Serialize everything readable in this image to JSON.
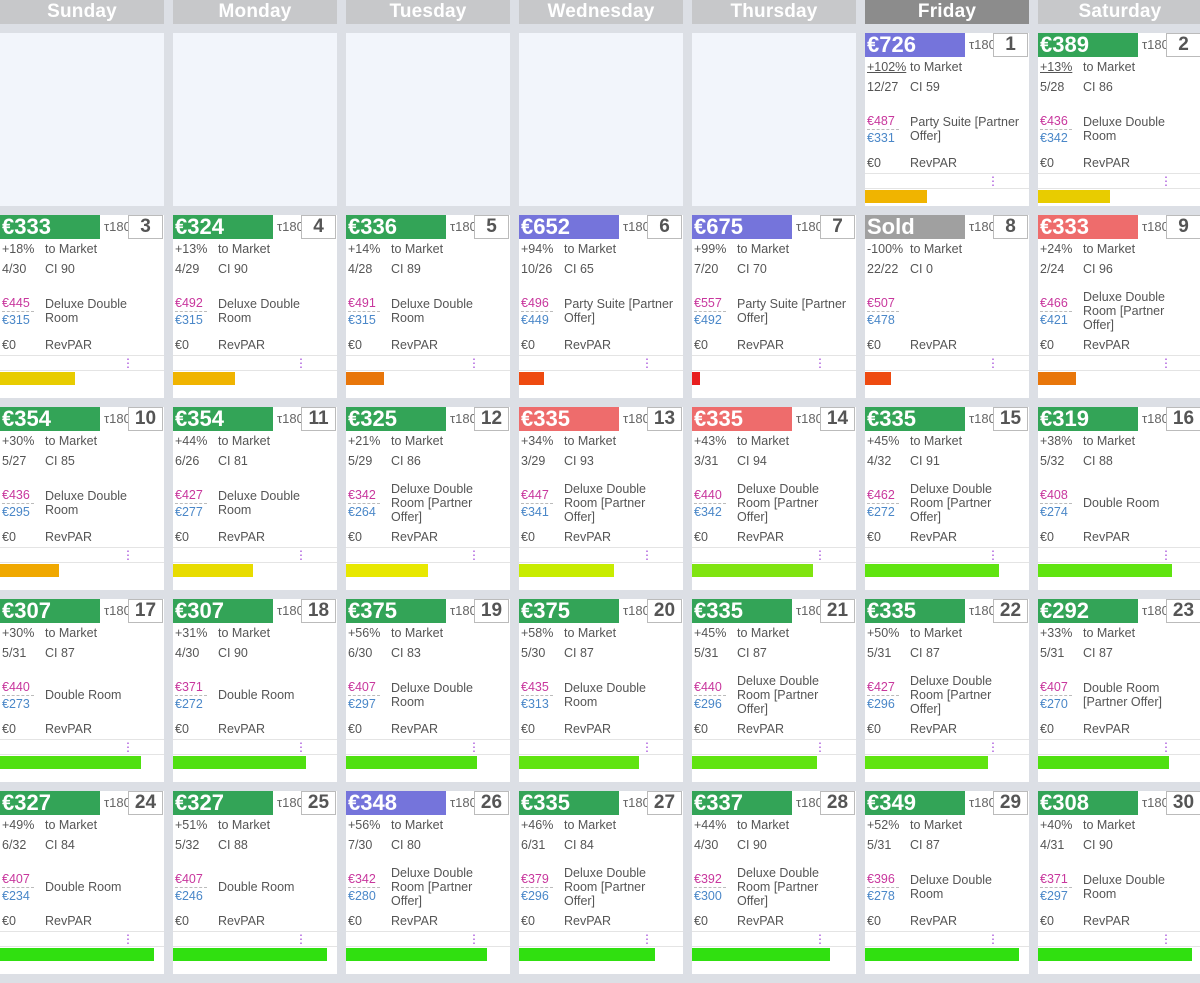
{
  "days": [
    "Sunday",
    "Monday",
    "Tuesday",
    "Wednesday",
    "Thursday",
    "Friday",
    "Saturday"
  ],
  "active_day": 5,
  "labels": {
    "market": "to Market",
    "revpar": "RevPAR",
    "tau": "τ180",
    "menu": "⋮"
  },
  "weeks": [
    [
      null,
      null,
      null,
      null,
      null,
      {
        "day": "1",
        "price": "€726",
        "price_color": "#7574db",
        "pct": "+102%",
        "occ": "12/27",
        "ci": "CI 59",
        "rate_a": "€487",
        "rate_b": "€331",
        "room": "Party Suite [Partner Offer]",
        "rev": "€0",
        "bar": 0.38,
        "bar_color": "#f0b400"
      },
      {
        "day": "2",
        "price": "€389",
        "price_color": "#33a457",
        "pct": "+13%",
        "occ": "5/28",
        "ci": "CI 86",
        "rate_a": "€436",
        "rate_b": "€342",
        "room": "Deluxe Double Room",
        "rev": "€0",
        "bar": 0.44,
        "bar_color": "#e8cc00"
      }
    ],
    [
      {
        "day": "3",
        "price": "€333",
        "price_color": "#33a457",
        "pct": "+18%",
        "occ": "4/30",
        "ci": "CI 90",
        "rate_a": "€445",
        "rate_b": "€315",
        "room": "Deluxe Double Room",
        "rev": "€0",
        "bar": 0.46,
        "bar_color": "#e8cc00"
      },
      {
        "day": "4",
        "price": "€324",
        "price_color": "#33a457",
        "pct": "+13%",
        "occ": "4/29",
        "ci": "CI 90",
        "rate_a": "€492",
        "rate_b": "€315",
        "room": "Deluxe Double Room",
        "rev": "€0",
        "bar": 0.38,
        "bar_color": "#f0b400"
      },
      {
        "day": "5",
        "price": "€336",
        "price_color": "#33a457",
        "pct": "+14%",
        "occ": "4/28",
        "ci": "CI 89",
        "rate_a": "€491",
        "rate_b": "€315",
        "room": "Deluxe Double Room",
        "rev": "€0",
        "bar": 0.23,
        "bar_color": "#e8760a"
      },
      {
        "day": "6",
        "price": "€652",
        "price_color": "#7574db",
        "pct": "+94%",
        "occ": "10/26",
        "ci": "CI 65",
        "rate_a": "€496",
        "rate_b": "€449",
        "room": "Party Suite [Partner Offer]",
        "rev": "€0",
        "bar": 0.15,
        "bar_color": "#ee4a10"
      },
      {
        "day": "7",
        "price": "€675",
        "price_color": "#7574db",
        "pct": "+99%",
        "occ": "7/20",
        "ci": "CI 70",
        "rate_a": "€557",
        "rate_b": "€492",
        "room": "Party Suite [Partner Offer]",
        "rev": "€0",
        "bar": 0.05,
        "bar_color": "#e81e1e"
      },
      {
        "day": "8",
        "price": "Sold",
        "price_color": "#a0a0a0",
        "pct": "-100%",
        "occ": "22/22",
        "ci": "CI 0",
        "rate_a": "€507",
        "rate_b": "€478",
        "room": "",
        "rev": "€0",
        "bar": 0.16,
        "bar_color": "#ee4a10"
      },
      {
        "day": "9",
        "price": "€333",
        "price_color": "#ee6c6c",
        "pct": "+24%",
        "occ": "2/24",
        "ci": "CI 96",
        "rate_a": "€466",
        "rate_b": "€421",
        "room": "Deluxe Double Room [Partner Offer]",
        "rev": "€0",
        "bar": 0.23,
        "bar_color": "#e8760a"
      }
    ],
    [
      {
        "day": "10",
        "price": "€354",
        "price_color": "#33a457",
        "pct": "+30%",
        "occ": "5/27",
        "ci": "CI 85",
        "rate_a": "€436",
        "rate_b": "€295",
        "room": "Deluxe Double Room",
        "rev": "€0",
        "bar": 0.36,
        "bar_color": "#f0a800"
      },
      {
        "day": "11",
        "price": "€354",
        "price_color": "#33a457",
        "pct": "+44%",
        "occ": "6/26",
        "ci": "CI 81",
        "rate_a": "€427",
        "rate_b": "€277",
        "room": "Deluxe Double Room",
        "rev": "€0",
        "bar": 0.49,
        "bar_color": "#e8dc00"
      },
      {
        "day": "12",
        "price": "€325",
        "price_color": "#33a457",
        "pct": "+21%",
        "occ": "5/29",
        "ci": "CI 86",
        "rate_a": "€342",
        "rate_b": "€264",
        "room": "Deluxe Double Room [Partner Offer]",
        "rev": "€0",
        "bar": 0.5,
        "bar_color": "#e8e800"
      },
      {
        "day": "13",
        "price": "€335",
        "price_color": "#ee6c6c",
        "pct": "+34%",
        "occ": "3/29",
        "ci": "CI 93",
        "rate_a": "€447",
        "rate_b": "€341",
        "room": "Deluxe Double Room [Partner Offer]",
        "rev": "€0",
        "bar": 0.58,
        "bar_color": "#c8ec00"
      },
      {
        "day": "14",
        "price": "€335",
        "price_color": "#ee6c6c",
        "pct": "+43%",
        "occ": "3/31",
        "ci": "CI 94",
        "rate_a": "€440",
        "rate_b": "€342",
        "room": "Deluxe Double Room [Partner Offer]",
        "rev": "€0",
        "bar": 0.74,
        "bar_color": "#80e410"
      },
      {
        "day": "15",
        "price": "€335",
        "price_color": "#33a457",
        "pct": "+45%",
        "occ": "4/32",
        "ci": "CI 91",
        "rate_a": "€462",
        "rate_b": "€272",
        "room": "Deluxe Double Room [Partner Offer]",
        "rev": "€0",
        "bar": 0.82,
        "bar_color": "#60e410"
      },
      {
        "day": "16",
        "price": "€319",
        "price_color": "#33a457",
        "pct": "+38%",
        "occ": "5/32",
        "ci": "CI 88",
        "rate_a": "€408",
        "rate_b": "€274",
        "room": "Double Room",
        "rev": "€0",
        "bar": 0.82,
        "bar_color": "#60e410"
      }
    ],
    [
      {
        "day": "17",
        "price": "€307",
        "price_color": "#33a457",
        "pct": "+30%",
        "occ": "5/31",
        "ci": "CI 87",
        "rate_a": "€440",
        "rate_b": "€273",
        "room": "Double Room",
        "rev": "€0",
        "bar": 0.86,
        "bar_color": "#50e010"
      },
      {
        "day": "18",
        "price": "€307",
        "price_color": "#33a457",
        "pct": "+31%",
        "occ": "4/30",
        "ci": "CI 90",
        "rate_a": "€371",
        "rate_b": "€272",
        "room": "Double Room",
        "rev": "€0",
        "bar": 0.81,
        "bar_color": "#50e010"
      },
      {
        "day": "19",
        "price": "€375",
        "price_color": "#33a457",
        "pct": "+56%",
        "occ": "6/30",
        "ci": "CI 83",
        "rate_a": "€407",
        "rate_b": "€297",
        "room": "Deluxe Double Room",
        "rev": "€0",
        "bar": 0.8,
        "bar_color": "#50e010"
      },
      {
        "day": "20",
        "price": "€375",
        "price_color": "#33a457",
        "pct": "+58%",
        "occ": "5/30",
        "ci": "CI 87",
        "rate_a": "€435",
        "rate_b": "€313",
        "room": "Deluxe Double Room",
        "rev": "€0",
        "bar": 0.73,
        "bar_color": "#60e410"
      },
      {
        "day": "21",
        "price": "€335",
        "price_color": "#33a457",
        "pct": "+45%",
        "occ": "5/31",
        "ci": "CI 87",
        "rate_a": "€440",
        "rate_b": "€296",
        "room": "Deluxe Double Room [Partner Offer]",
        "rev": "€0",
        "bar": 0.76,
        "bar_color": "#60e410"
      },
      {
        "day": "22",
        "price": "€335",
        "price_color": "#33a457",
        "pct": "+50%",
        "occ": "5/31",
        "ci": "CI 87",
        "rate_a": "€427",
        "rate_b": "€296",
        "room": "Deluxe Double Room [Partner Offer]",
        "rev": "€0",
        "bar": 0.75,
        "bar_color": "#60e410"
      },
      {
        "day": "23",
        "price": "€292",
        "price_color": "#33a457",
        "pct": "+33%",
        "occ": "5/31",
        "ci": "CI 87",
        "rate_a": "€407",
        "rate_b": "€270",
        "room": "Double Room [Partner Offer]",
        "rev": "€0",
        "bar": 0.8,
        "bar_color": "#50e010"
      }
    ],
    [
      {
        "day": "24",
        "price": "€327",
        "price_color": "#33a457",
        "pct": "+49%",
        "occ": "6/32",
        "ci": "CI 84",
        "rate_a": "€407",
        "rate_b": "€234",
        "room": "Double Room",
        "rev": "€0",
        "bar": 0.94,
        "bar_color": "#30e010"
      },
      {
        "day": "25",
        "price": "€327",
        "price_color": "#33a457",
        "pct": "+51%",
        "occ": "5/32",
        "ci": "CI 88",
        "rate_a": "€407",
        "rate_b": "€246",
        "room": "Double Room",
        "rev": "€0",
        "bar": 0.94,
        "bar_color": "#30e010"
      },
      {
        "day": "26",
        "price": "€348",
        "price_color": "#7574db",
        "pct": "+56%",
        "occ": "7/30",
        "ci": "CI 80",
        "rate_a": "€342",
        "rate_b": "€280",
        "room": "Deluxe Double Room [Partner Offer]",
        "rev": "€0",
        "bar": 0.86,
        "bar_color": "#30e010"
      },
      {
        "day": "27",
        "price": "€335",
        "price_color": "#33a457",
        "pct": "+46%",
        "occ": "6/31",
        "ci": "CI 84",
        "rate_a": "€379",
        "rate_b": "€296",
        "room": "Deluxe Double Room [Partner Offer]",
        "rev": "€0",
        "bar": 0.83,
        "bar_color": "#30e010"
      },
      {
        "day": "28",
        "price": "€337",
        "price_color": "#33a457",
        "pct": "+44%",
        "occ": "4/30",
        "ci": "CI 90",
        "rate_a": "€392",
        "rate_b": "€300",
        "room": "Deluxe Double Room [Partner Offer]",
        "rev": "€0",
        "bar": 0.84,
        "bar_color": "#30e010"
      },
      {
        "day": "29",
        "price": "€349",
        "price_color": "#33a457",
        "pct": "+52%",
        "occ": "5/31",
        "ci": "CI 87",
        "rate_a": "€396",
        "rate_b": "€278",
        "room": "Deluxe Double Room",
        "rev": "€0",
        "bar": 0.94,
        "bar_color": "#30e010"
      },
      {
        "day": "30",
        "price": "€308",
        "price_color": "#33a457",
        "pct": "+40%",
        "occ": "4/31",
        "ci": "CI 90",
        "rate_a": "€371",
        "rate_b": "€297",
        "room": "Deluxe Double Room",
        "rev": "€0",
        "bar": 0.94,
        "bar_color": "#30e010"
      }
    ]
  ]
}
